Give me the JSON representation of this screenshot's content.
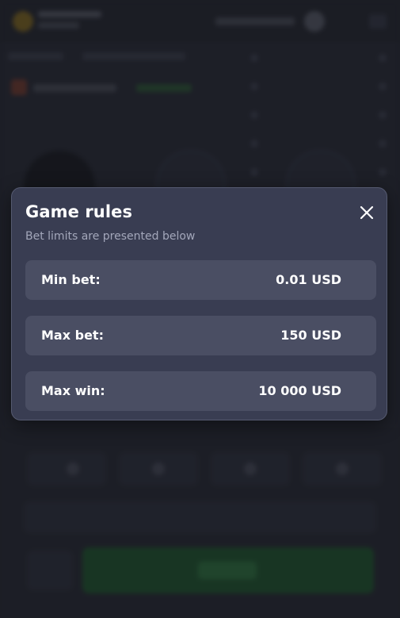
{
  "modal": {
    "title": "Game rules",
    "subtitle": "Bet limits are presented below",
    "close_icon": "close-icon",
    "rows": [
      {
        "label": "Min bet:",
        "value": "0.01 USD"
      },
      {
        "label": "Max bet:",
        "value": "150 USD"
      },
      {
        "label": "Max win:",
        "value": "10 000 USD"
      }
    ]
  },
  "colors": {
    "modal_background": "#393d52",
    "row_background": "#4a4e63",
    "subtitle_text": "#a3a7ba",
    "play_button": "#1c5a2c"
  }
}
